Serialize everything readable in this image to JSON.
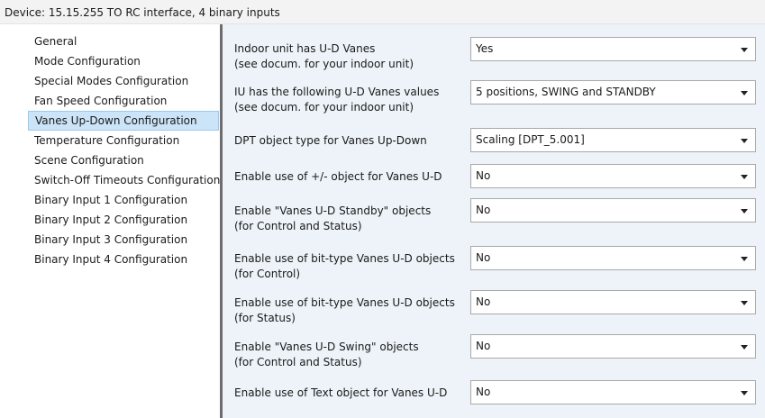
{
  "device_title": "Device: 15.15.255  TO RC interface, 4 binary inputs",
  "sidebar": {
    "items": [
      {
        "label": "General"
      },
      {
        "label": "Mode Configuration"
      },
      {
        "label": "Special Modes Configuration"
      },
      {
        "label": "Fan Speed Configuration"
      },
      {
        "label": "Vanes Up-Down Configuration",
        "selected": true
      },
      {
        "label": "Temperature Configuration"
      },
      {
        "label": "Scene Configuration"
      },
      {
        "label": "Switch-Off Timeouts Configuration"
      },
      {
        "label": "Binary Input 1 Configuration"
      },
      {
        "label": "Binary Input 2 Configuration"
      },
      {
        "label": "Binary Input 3 Configuration"
      },
      {
        "label": "Binary Input 4 Configuration"
      }
    ]
  },
  "params": [
    {
      "line1": "Indoor unit has U-D Vanes",
      "line2": "(see docum. for your indoor unit)",
      "value": "Yes"
    },
    {
      "line1": "IU has the following U-D Vanes values",
      "line2": "(see docum. for your indoor unit)",
      "value": "5 positions, SWING and STANDBY"
    },
    {
      "line1": "DPT object type for Vanes Up-Down",
      "line2": "",
      "value": "Scaling [DPT_5.001]"
    },
    {
      "line1": "Enable use of +/- object for Vanes U-D",
      "line2": "",
      "value": "No"
    },
    {
      "line1": "Enable \"Vanes U-D Standby\" objects",
      "line2": "(for Control and Status)",
      "value": "No"
    },
    {
      "line1": "Enable use of bit-type Vanes U-D objects",
      "line2": "(for Control)",
      "value": "No"
    },
    {
      "line1": "Enable use of bit-type Vanes U-D objects",
      "line2": "(for Status)",
      "value": "No"
    },
    {
      "line1": "Enable \"Vanes U-D Swing\" objects",
      "line2": "(for Control and Status)",
      "value": "No"
    },
    {
      "line1": "Enable use of Text object for Vanes U-D",
      "line2": "",
      "value": "No"
    }
  ]
}
